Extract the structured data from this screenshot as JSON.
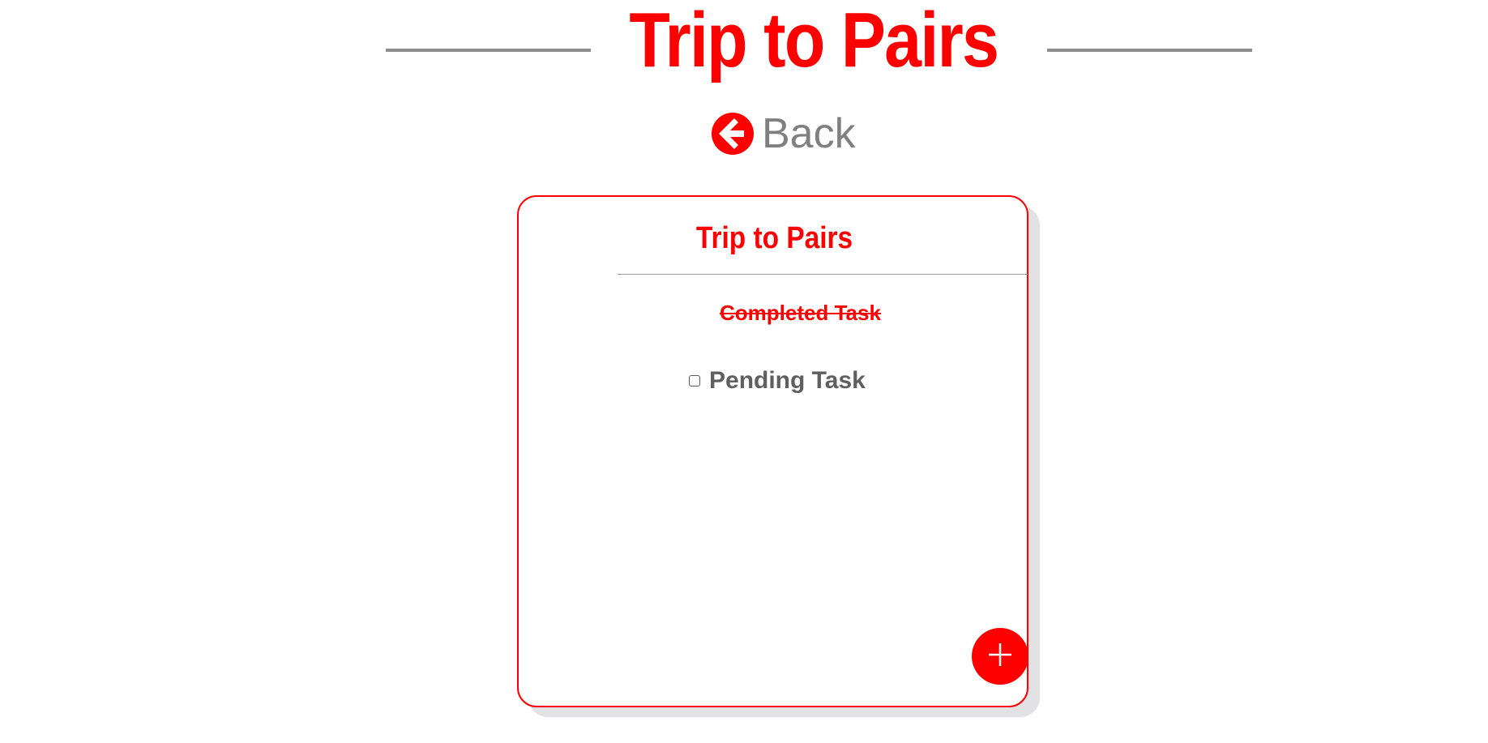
{
  "header": {
    "title": "Trip to Pairs"
  },
  "back": {
    "label": "Back",
    "icon": "arrow-left-circle-icon"
  },
  "card": {
    "title": "Trip to Pairs",
    "tasks": [
      {
        "label": "Completed Task",
        "completed": true
      },
      {
        "label": "Pending Task",
        "completed": false
      }
    ],
    "add_button_icon": "plus-icon"
  },
  "colors": {
    "accent": "#ff0000",
    "line_gray": "#8f8f8f",
    "text_gray": "#808080",
    "shadow": "#e2e2e4"
  }
}
